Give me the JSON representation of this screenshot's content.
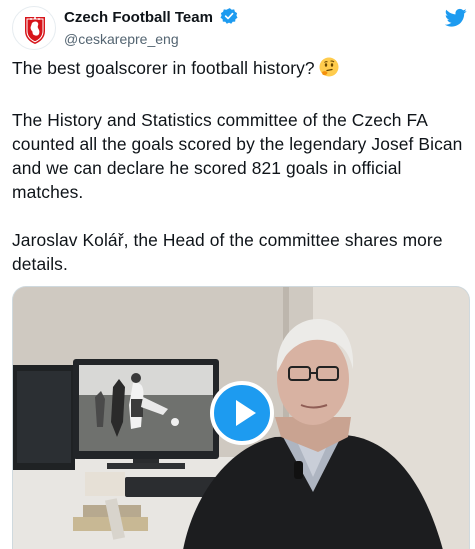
{
  "account": {
    "display_name": "Czech Football Team",
    "handle": "@ceskarepre_eng",
    "avatar_icon": "czech-lion-crest-icon",
    "verified_icon": "verified-badge-icon",
    "brand_icon": "twitter-bird-icon"
  },
  "tweet": {
    "line1": "The best goalscorer in football history?",
    "line1_emoji": "thinking-face-emoji",
    "para2": "The History and Statistics committee of the Czech FA counted all the goals scored by the legendary Josef Bican and we can declare he scored 821 goals in official matches.",
    "para3": "Jaroslav Kolář, the Head of the committee shares more details."
  },
  "media": {
    "type": "video",
    "play_icon": "play-icon"
  },
  "colors": {
    "brand_blue": "#1d9bf0",
    "text": "#0f1419",
    "secondary_text": "#536471",
    "crest_red": "#d7141a"
  }
}
